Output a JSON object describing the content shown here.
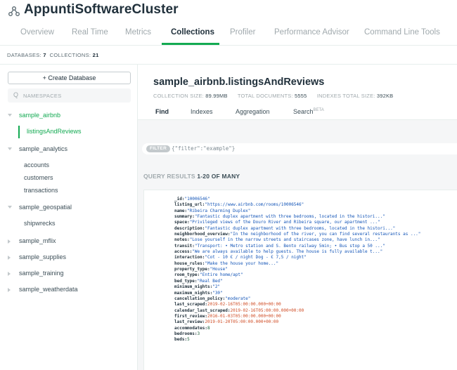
{
  "header": {
    "cluster_name": "AppuntiSoftwareCluster",
    "tabs": [
      {
        "label": "Overview"
      },
      {
        "label": "Real Time"
      },
      {
        "label": "Metrics"
      },
      {
        "label": "Collections"
      },
      {
        "label": "Profiler"
      },
      {
        "label": "Performance Advisor"
      },
      {
        "label": "Command Line Tools"
      }
    ],
    "active_tab": "Collections"
  },
  "db_stats": {
    "databases_label": "DATABASES:",
    "databases_count": "7",
    "collections_label": "COLLECTIONS:",
    "collections_count": "21"
  },
  "sidebar": {
    "create_label": "+ Create Database",
    "search_placeholder": "NAMESPACES",
    "search_icon": "Q",
    "databases": [
      {
        "name": "sample_airbnb",
        "expanded": true,
        "active": true,
        "collections": [
          "listingsAndReviews"
        ]
      },
      {
        "name": "sample_analytics",
        "expanded": true,
        "collections": [
          "accounts",
          "customers",
          "transactions"
        ]
      },
      {
        "name": "sample_geospatial",
        "expanded": true,
        "collections": [
          "shipwrecks"
        ]
      },
      {
        "name": "sample_mflix",
        "expanded": false
      },
      {
        "name": "sample_supplies",
        "expanded": false
      },
      {
        "name": "sample_training",
        "expanded": false
      },
      {
        "name": "sample_weatherdata",
        "expanded": false
      }
    ]
  },
  "collection": {
    "namespace": "sample_airbnb.listingsAndReviews",
    "size_label": "COLLECTION SIZE:",
    "size_value": "89.99MB",
    "docs_label": "TOTAL DOCUMENTS:",
    "docs_value": "5555",
    "index_label": "INDEXES TOTAL SIZE:",
    "index_value": "392KB",
    "tabs": [
      {
        "label": "Find"
      },
      {
        "label": "Indexes"
      },
      {
        "label": "Aggregation"
      },
      {
        "label": "Search",
        "badge": "BETA"
      }
    ],
    "active_tab": "Find"
  },
  "filter": {
    "pill": "FILTER",
    "text": "{\"filter\":\"example\"}"
  },
  "results": {
    "prefix": "QUERY RESULTS",
    "range": "1-20 OF MANY"
  },
  "document": [
    {
      "key": "_id",
      "value": "\"10006546\"",
      "type": "s"
    },
    {
      "key": "listing_url",
      "value": "\"https://www.airbnb.com/rooms/10006546\"",
      "type": "s"
    },
    {
      "key": "name",
      "value": "\"Ribeira Charming Duplex\"",
      "type": "s"
    },
    {
      "key": "summary",
      "value": "\"Fantastic duplex apartment with three bedrooms, located in the histori...\"",
      "type": "s"
    },
    {
      "key": "space",
      "value": "\"Privileged views of the Douro River and Ribeira square, our apartment ...\"",
      "type": "s"
    },
    {
      "key": "description",
      "value": "\"Fantastic duplex apartment with three bedrooms, located in the histori...\"",
      "type": "s"
    },
    {
      "key": "neighborhood_overview",
      "value": "\"In the neighborhood of the river, you can find several restaurants as ...\"",
      "type": "s"
    },
    {
      "key": "notes",
      "value": "\"Lose yourself in the narrow streets and staircases zone, have lunch in...\"",
      "type": "s"
    },
    {
      "key": "transit",
      "value": "\"Transport: • Metro station and S. Bento railway 5min; • Bus stop a 50 ...\"",
      "type": "s"
    },
    {
      "key": "access",
      "value": "\"We are always available to help guests. The house is fully available t...\"",
      "type": "s"
    },
    {
      "key": "interaction",
      "value": "\"Cot - 10 € / night Dog - € 7,5 / night\"",
      "type": "s"
    },
    {
      "key": "house_rules",
      "value": "\"Make the house your home...\"",
      "type": "s"
    },
    {
      "key": "property_type",
      "value": "\"House\"",
      "type": "s"
    },
    {
      "key": "room_type",
      "value": "\"Entire home/apt\"",
      "type": "s"
    },
    {
      "key": "bed_type",
      "value": "\"Real Bed\"",
      "type": "s"
    },
    {
      "key": "minimum_nights",
      "value": "\"2\"",
      "type": "s"
    },
    {
      "key": "maximum_nights",
      "value": "\"30\"",
      "type": "s"
    },
    {
      "key": "cancellation_policy",
      "value": "\"moderate\"",
      "type": "s"
    },
    {
      "key": "last_scraped",
      "value": "2019-02-16T05:00:00.000+00:00",
      "type": "d"
    },
    {
      "key": "calendar_last_scraped",
      "value": "2019-02-16T05:00:00.000+00:00",
      "type": "d"
    },
    {
      "key": "first_review",
      "value": "2016-01-03T05:00:00.000+00:00",
      "type": "d"
    },
    {
      "key": "last_review",
      "value": "2019-01-20T05:00:00.000+00:00",
      "type": "d"
    },
    {
      "key": "accommodates",
      "value": "8",
      "type": "n"
    },
    {
      "key": "bedrooms",
      "value": "3",
      "type": "n"
    },
    {
      "key": "beds",
      "value": "5",
      "type": "n"
    }
  ],
  "colors": {
    "accent_green": "#13aa52",
    "string_blue": "#1254b7",
    "date_red": "#cf4a22"
  }
}
